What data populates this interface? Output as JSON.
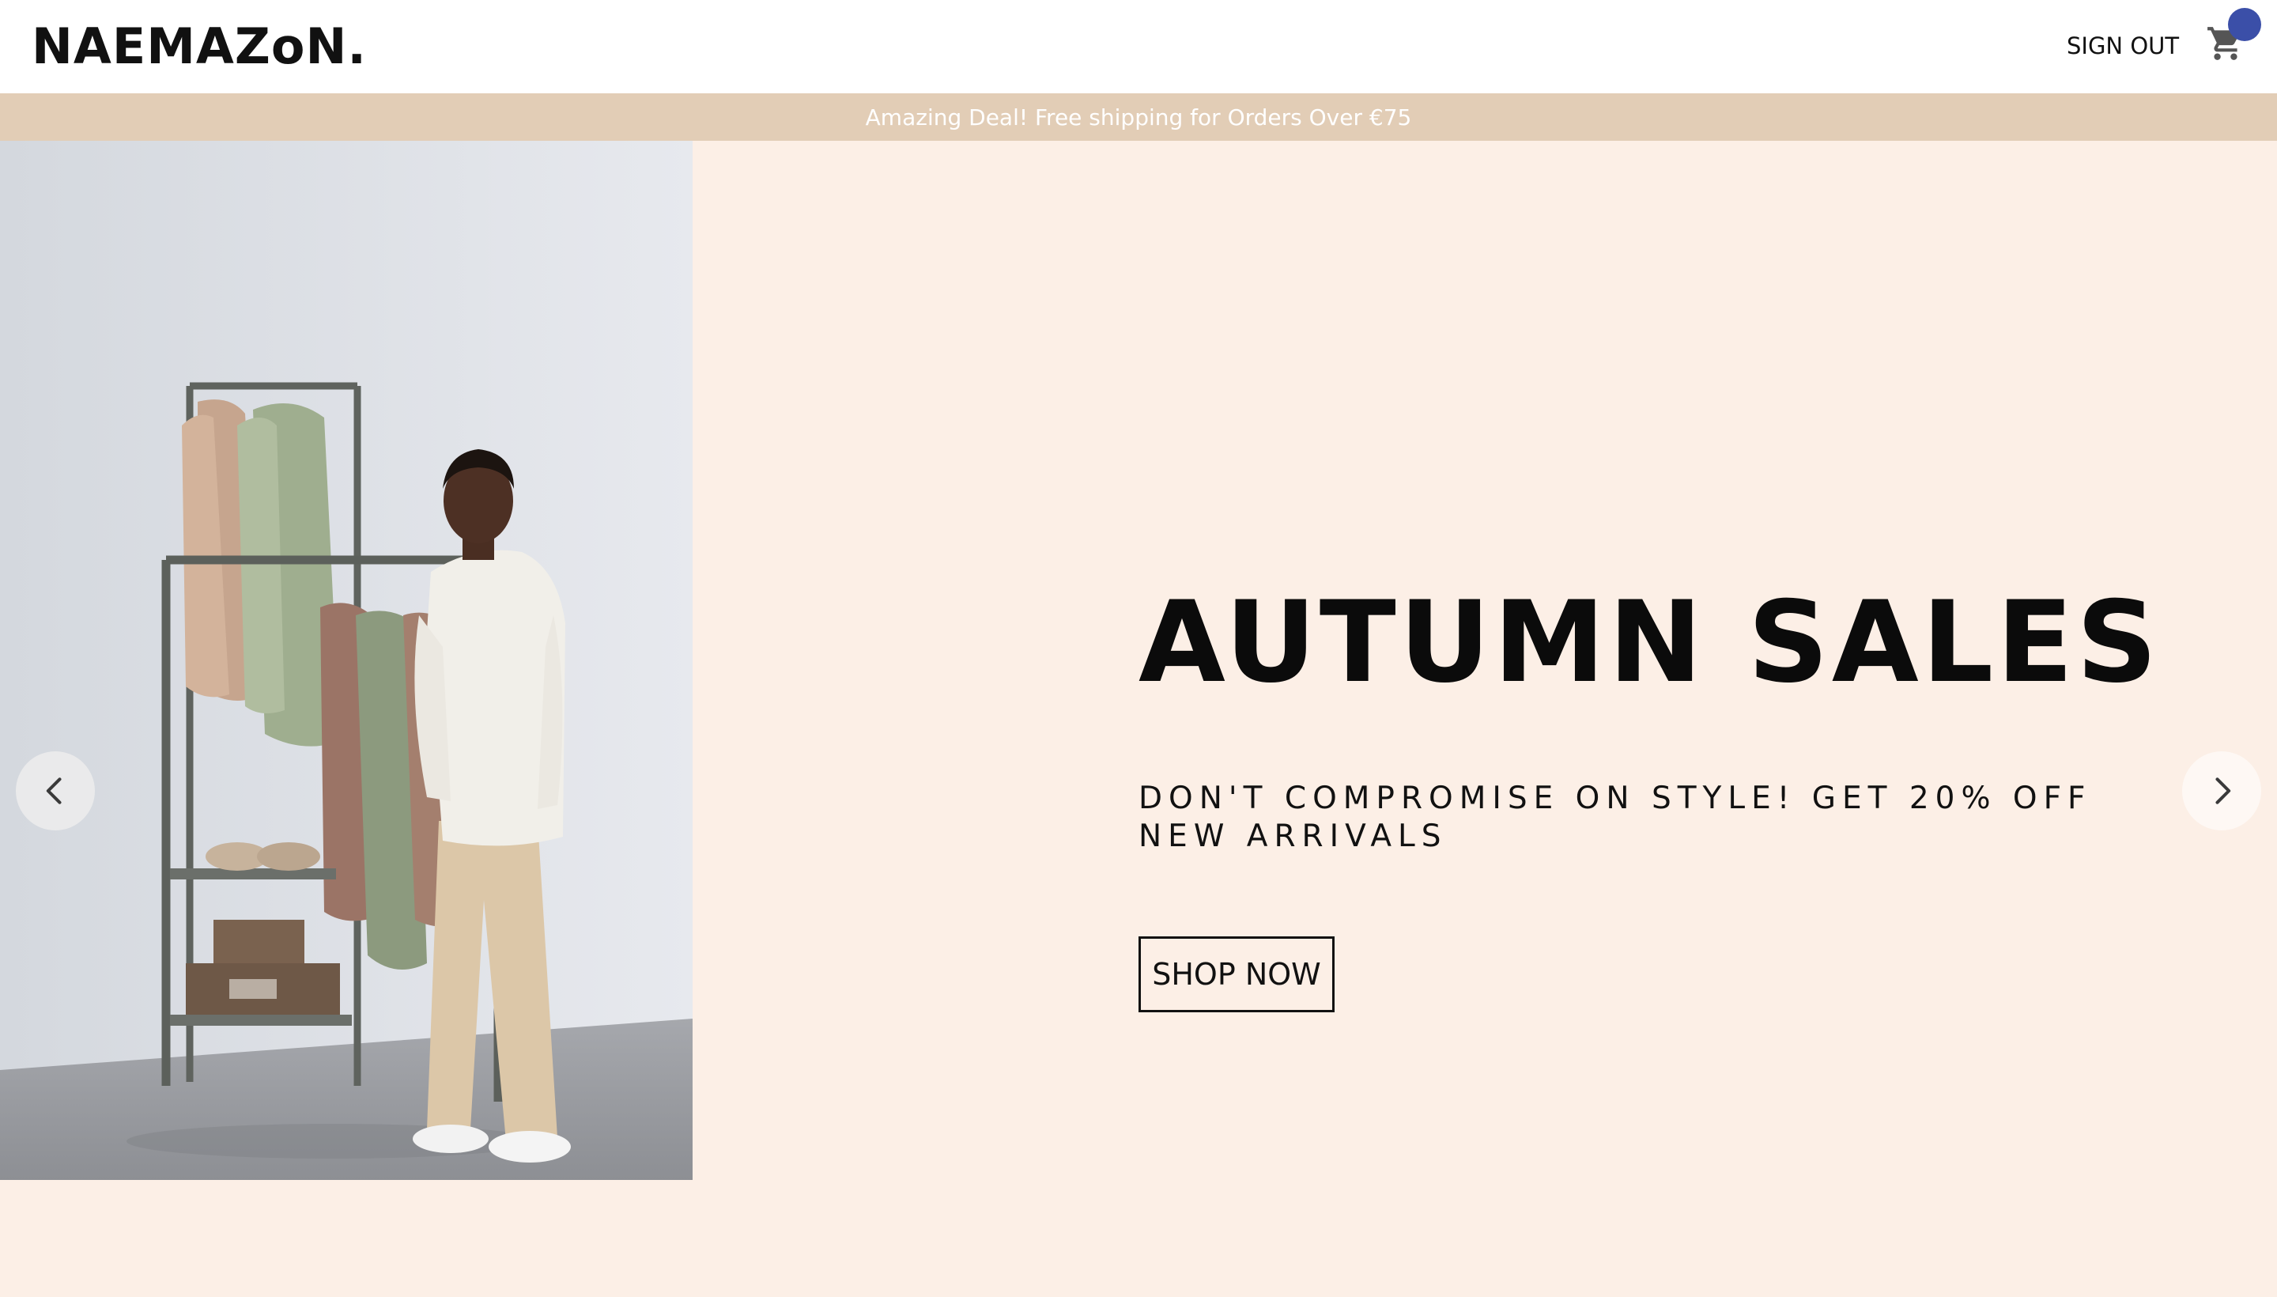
{
  "header": {
    "logo_text": "NAEMAZoN.",
    "sign_out_label": "SIGN OUT",
    "cart_icon": "shopping-cart-icon"
  },
  "promo": {
    "text": "Amazing Deal! Free shipping for Orders Over €75"
  },
  "hero": {
    "title": "AUTUMN SALES",
    "subtitle": "DON'T COMPROMISE ON STYLE! GET 20% OFF NEW ARRIVALS",
    "cta_label": "SHOP NOW",
    "prev_icon": "chevron-left-icon",
    "next_icon": "chevron-right-icon"
  },
  "colors": {
    "header_bg": "#ffffff",
    "promo_bg": "#e2cdb6",
    "hero_bg": "#fcefe6",
    "cart_badge": "#3b4fa8",
    "text": "#111111"
  }
}
